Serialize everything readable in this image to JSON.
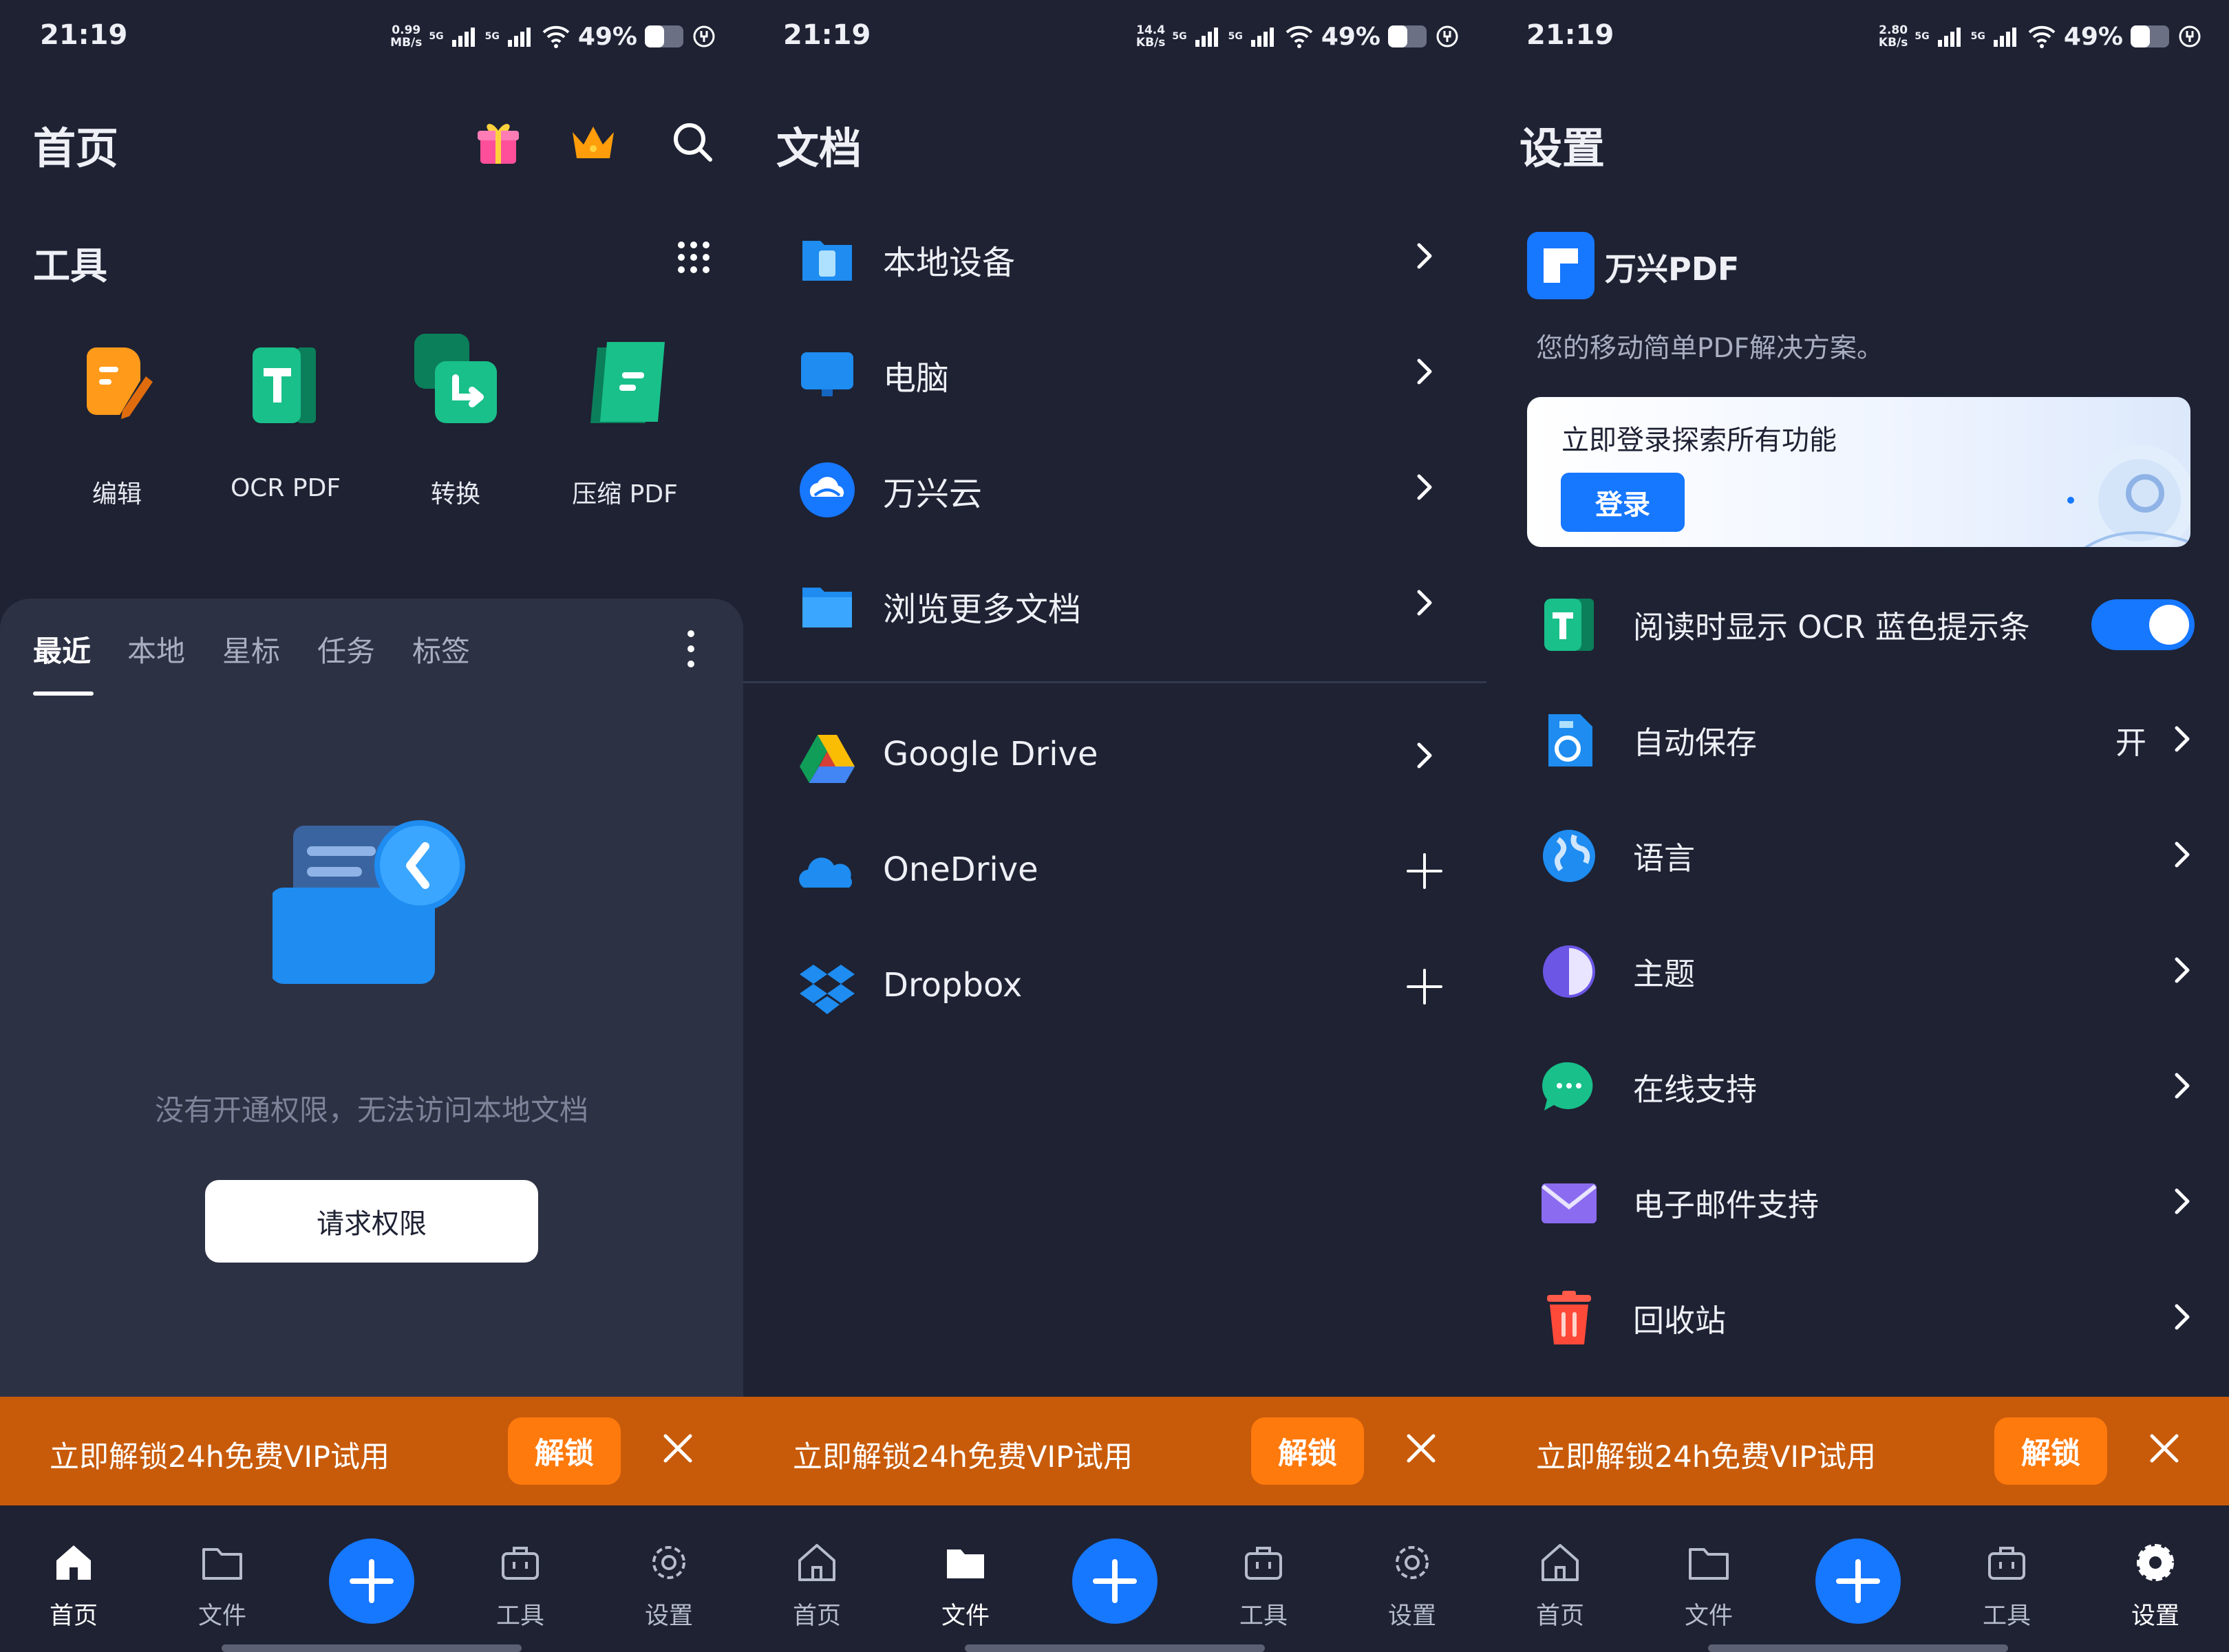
{
  "status_bar": {
    "time": "21:19",
    "battery": "49%",
    "net_speed_1": "0.99",
    "net_unit_1": "MB/s",
    "net_speed_2": "14.4",
    "net_unit_2": "KB/s",
    "net_speed_3": "2.80",
    "net_unit_3": "KB/s",
    "signal_label": "5G"
  },
  "home": {
    "title": "首页",
    "tools_title": "工具",
    "tools": [
      {
        "label": "编辑",
        "icon": "edit-pdf-icon"
      },
      {
        "label": "OCR PDF",
        "icon": "ocr-icon"
      },
      {
        "label": "转换",
        "icon": "convert-icon"
      },
      {
        "label": "压缩 PDF",
        "icon": "compress-icon"
      }
    ],
    "tabs": [
      "最近",
      "本地",
      "星标",
      "任务",
      "标签"
    ],
    "empty_message": "没有开通权限，无法访问本地文档",
    "request_button": "请求权限"
  },
  "files": {
    "title": "文档",
    "locations": [
      {
        "label": "本地设备",
        "icon": "phone-icon"
      },
      {
        "label": "电脑",
        "icon": "monitor-icon"
      },
      {
        "label": "万兴云",
        "icon": "cloud-icon"
      },
      {
        "label": "浏览更多文档",
        "icon": "folder-icon"
      }
    ],
    "cloud": [
      {
        "label": "Google Drive",
        "icon": "google-drive-icon",
        "action": "chevron"
      },
      {
        "label": "OneDrive",
        "icon": "onedrive-icon",
        "action": "plus"
      },
      {
        "label": "Dropbox",
        "icon": "dropbox-icon",
        "action": "plus"
      }
    ]
  },
  "settings": {
    "title": "设置",
    "brand_name": "万兴PDF",
    "brand_subtitle": "您的移动简单PDF解决方案。",
    "login_title": "立即登录探索所有功能",
    "login_button": "登录",
    "items": [
      {
        "label": "阅读时显示 OCR 蓝色提示条",
        "icon": "ocr-icon",
        "type": "toggle"
      },
      {
        "label": "自动保存",
        "icon": "autosave-icon",
        "type": "value",
        "value": "开"
      },
      {
        "label": "语言",
        "icon": "globe-icon",
        "type": "chevron"
      },
      {
        "label": "主题",
        "icon": "theme-icon",
        "type": "chevron"
      },
      {
        "label": "在线支持",
        "icon": "chat-icon",
        "type": "chevron"
      },
      {
        "label": "电子邮件支持",
        "icon": "mail-icon",
        "type": "chevron"
      },
      {
        "label": "回收站",
        "icon": "trash-icon",
        "type": "chevron"
      }
    ],
    "ocr_toggle_on": true
  },
  "banner": {
    "text": "立即解锁24h免费VIP试用",
    "button": "解锁"
  },
  "nav": {
    "home": "首页",
    "files": "文件",
    "tools": "工具",
    "settings": "设置"
  },
  "colors": {
    "background": "#1e2233",
    "card": "#2c3144",
    "accent": "#1677ff",
    "banner": "#c85b0a",
    "banner_button": "#ff7a0d"
  }
}
